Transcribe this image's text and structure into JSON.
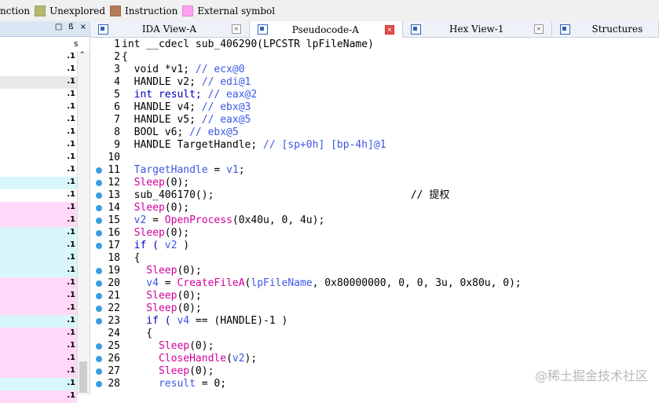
{
  "legend": [
    {
      "label": "nction",
      "color": ""
    },
    {
      "label": "Unexplored",
      "color": "#b5b86e"
    },
    {
      "label": "Instruction",
      "color": "#b57a56"
    },
    {
      "label": "External symbol",
      "color": "#ff9ff0"
    }
  ],
  "left_panel": {
    "header_buttons": [
      "□",
      "ß",
      "×"
    ],
    "column_label": "s",
    "rows": [
      {
        "mark": ".1",
        "bg": "#ffffff"
      },
      {
        "mark": ".1",
        "bg": "#ffffff"
      },
      {
        "mark": ".1",
        "bg": "#e9e9e9"
      },
      {
        "mark": ".1",
        "bg": "#ffffff"
      },
      {
        "mark": ".1",
        "bg": "#ffffff"
      },
      {
        "mark": ".1",
        "bg": "#ffffff"
      },
      {
        "mark": ".1",
        "bg": "#ffffff"
      },
      {
        "mark": ".1",
        "bg": "#ffffff"
      },
      {
        "mark": ".1",
        "bg": "#ffffff"
      },
      {
        "mark": ".1",
        "bg": "#ffffff"
      },
      {
        "mark": ".1",
        "bg": "#d9f7fb"
      },
      {
        "mark": ".1",
        "bg": "#ffffff"
      },
      {
        "mark": ".1",
        "bg": "#ffd9f7"
      },
      {
        "mark": ".1",
        "bg": "#ffd9f7"
      },
      {
        "mark": ".1",
        "bg": "#d9f7fb"
      },
      {
        "mark": ".1",
        "bg": "#d9f7fb"
      },
      {
        "mark": ".1",
        "bg": "#d9f7fb"
      },
      {
        "mark": ".1",
        "bg": "#d9f7fb"
      },
      {
        "mark": ".1",
        "bg": "#ffd9f7"
      },
      {
        "mark": ".1",
        "bg": "#ffd9f7"
      },
      {
        "mark": ".1",
        "bg": "#ffd9f7"
      },
      {
        "mark": ".1",
        "bg": "#d9f7fb"
      },
      {
        "mark": ".1",
        "bg": "#ffd9f7"
      },
      {
        "mark": ".1",
        "bg": "#ffd9f7"
      },
      {
        "mark": ".1",
        "bg": "#ffd9f7"
      },
      {
        "mark": ".1",
        "bg": "#ffd9f7"
      },
      {
        "mark": ".1",
        "bg": "#d9f7fb"
      },
      {
        "mark": ".1",
        "bg": "#ffd9f7"
      }
    ]
  },
  "tabs": [
    {
      "label": "IDA View-A",
      "active": false,
      "close": "×",
      "red": false
    },
    {
      "label": "Pseudocode-A",
      "active": true,
      "close": "×",
      "red": true
    },
    {
      "label": "Hex View-1",
      "active": false,
      "close": "×",
      "red": false
    },
    {
      "label": "Structures",
      "active": false,
      "close": "",
      "red": false
    }
  ],
  "code": [
    {
      "n": "1",
      "dot": false,
      "t": "int __cdecl sub_406290(LPCSTR lpFileName)",
      "cls": ""
    },
    {
      "n": "2",
      "dot": false,
      "t": "{",
      "cls": ""
    },
    {
      "n": "3",
      "dot": false,
      "segs": [
        [
          "  void *v1; ",
          ""
        ],
        [
          "// ecx@0",
          "cmt-blue"
        ]
      ]
    },
    {
      "n": "4",
      "dot": false,
      "segs": [
        [
          "  HANDLE v2; ",
          ""
        ],
        [
          "// edi@1",
          "cmt-blue"
        ]
      ]
    },
    {
      "n": "5",
      "dot": false,
      "segs": [
        [
          "  int result; ",
          "kw-blue"
        ],
        [
          "// eax@2",
          "cmt-blue"
        ]
      ]
    },
    {
      "n": "6",
      "dot": false,
      "segs": [
        [
          "  HANDLE v4; ",
          ""
        ],
        [
          "// ebx@3",
          "cmt-blue"
        ]
      ]
    },
    {
      "n": "7",
      "dot": false,
      "segs": [
        [
          "  HANDLE v5; ",
          ""
        ],
        [
          "// eax@5",
          "cmt-blue"
        ]
      ]
    },
    {
      "n": "8",
      "dot": false,
      "segs": [
        [
          "  BOOL v6; ",
          ""
        ],
        [
          "// ebx@5",
          "cmt-blue"
        ]
      ]
    },
    {
      "n": "9",
      "dot": false,
      "segs": [
        [
          "  HANDLE TargetHandle; ",
          ""
        ],
        [
          "// [sp+0h] [bp-4h]@1",
          "cmt-blue"
        ]
      ]
    },
    {
      "n": "10",
      "dot": false,
      "t": "",
      "cls": ""
    },
    {
      "n": "11",
      "dot": true,
      "segs": [
        [
          "  TargetHandle",
          "var-blue"
        ],
        [
          " = ",
          ""
        ],
        [
          "v1",
          "var-blue"
        ],
        [
          ";",
          ""
        ]
      ]
    },
    {
      "n": "12",
      "dot": true,
      "segs": [
        [
          "  Sleep",
          "fn-pink"
        ],
        [
          "(0);",
          ""
        ]
      ]
    },
    {
      "n": "13",
      "dot": true,
      "segs": [
        [
          "  sub_406170();                                // 提权",
          ""
        ]
      ]
    },
    {
      "n": "14",
      "dot": true,
      "segs": [
        [
          "  Sleep",
          "fn-pink"
        ],
        [
          "(0);",
          ""
        ]
      ]
    },
    {
      "n": "15",
      "dot": true,
      "segs": [
        [
          "  v2",
          "var-blue"
        ],
        [
          " = ",
          ""
        ],
        [
          "OpenProcess",
          "fn-pink"
        ],
        [
          "(0x40u, 0, 4u);",
          ""
        ]
      ]
    },
    {
      "n": "16",
      "dot": true,
      "segs": [
        [
          "  Sleep",
          "fn-pink"
        ],
        [
          "(0);",
          ""
        ]
      ]
    },
    {
      "n": "17",
      "dot": true,
      "segs": [
        [
          "  if ( ",
          "kw-blue"
        ],
        [
          "v2",
          "var-blue"
        ],
        [
          " )",
          ""
        ]
      ]
    },
    {
      "n": "18",
      "dot": false,
      "t": "  {",
      "cls": ""
    },
    {
      "n": "19",
      "dot": true,
      "segs": [
        [
          "    Sleep",
          "fn-pink"
        ],
        [
          "(0);",
          ""
        ]
      ]
    },
    {
      "n": "20",
      "dot": true,
      "segs": [
        [
          "    v4",
          "var-blue"
        ],
        [
          " = ",
          ""
        ],
        [
          "CreateFileA",
          "fn-pink"
        ],
        [
          "(",
          ""
        ],
        [
          "lpFileName",
          "var-blue"
        ],
        [
          ", 0x80000000, 0, 0, 3u, 0x80u, 0);",
          ""
        ]
      ]
    },
    {
      "n": "21",
      "dot": true,
      "segs": [
        [
          "    Sleep",
          "fn-pink"
        ],
        [
          "(0);",
          ""
        ]
      ]
    },
    {
      "n": "22",
      "dot": true,
      "segs": [
        [
          "    Sleep",
          "fn-pink"
        ],
        [
          "(0);",
          ""
        ]
      ]
    },
    {
      "n": "23",
      "dot": true,
      "segs": [
        [
          "    if ( ",
          "kw-blue"
        ],
        [
          "v4",
          "var-blue"
        ],
        [
          " == (HANDLE)-1 )",
          ""
        ]
      ]
    },
    {
      "n": "24",
      "dot": false,
      "t": "    {",
      "cls": ""
    },
    {
      "n": "25",
      "dot": true,
      "segs": [
        [
          "      Sleep",
          "fn-pink"
        ],
        [
          "(0);",
          ""
        ]
      ]
    },
    {
      "n": "26",
      "dot": true,
      "segs": [
        [
          "      CloseHandle",
          "fn-pink"
        ],
        [
          "(",
          ""
        ],
        [
          "v2",
          "var-blue"
        ],
        [
          ");",
          ""
        ]
      ]
    },
    {
      "n": "27",
      "dot": true,
      "segs": [
        [
          "      Sleep",
          "fn-pink"
        ],
        [
          "(0);",
          ""
        ]
      ]
    },
    {
      "n": "28",
      "dot": true,
      "segs": [
        [
          "      result",
          "var-blue"
        ],
        [
          " = 0;",
          ""
        ]
      ]
    }
  ],
  "watermark": "@稀土掘金技术社区"
}
